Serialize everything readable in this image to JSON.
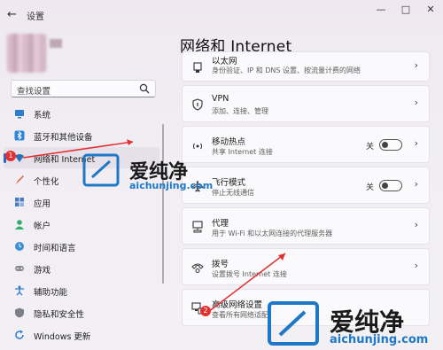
{
  "window": {
    "app_title": "设置",
    "back_glyph": "←",
    "min_glyph": "—",
    "max_glyph": "□",
    "close_glyph": "✕"
  },
  "search": {
    "placeholder": "查找设置"
  },
  "sidebar": {
    "items": [
      {
        "label": "系统",
        "icon": "monitor-icon"
      },
      {
        "label": "蓝牙和其他设备",
        "icon": "bluetooth-icon"
      },
      {
        "label": "网络和 Internet",
        "icon": "wifi-icon",
        "active": true
      },
      {
        "label": "个性化",
        "icon": "brush-icon"
      },
      {
        "label": "应用",
        "icon": "apps-icon"
      },
      {
        "label": "帐户",
        "icon": "account-icon"
      },
      {
        "label": "时间和语言",
        "icon": "globe-clock-icon"
      },
      {
        "label": "游戏",
        "icon": "gamepad-icon"
      },
      {
        "label": "辅助功能",
        "icon": "accessibility-icon"
      },
      {
        "label": "隐私和安全性",
        "icon": "shield-icon"
      },
      {
        "label": "Windows 更新",
        "icon": "update-icon"
      }
    ]
  },
  "main": {
    "title": "网络和 Internet",
    "cards": [
      {
        "title": "以太网",
        "subtitle": "身份验证、IP 和 DNS 设置、按流量计费的网络",
        "icon": "ethernet-icon"
      },
      {
        "title": "VPN",
        "subtitle": "添加、连接、管理",
        "icon": "vpn-shield-icon"
      },
      {
        "title": "移动热点",
        "subtitle": "共享 Internet 连接",
        "icon": "hotspot-icon",
        "toggle_label": "关",
        "toggle_on": false
      },
      {
        "title": "飞行模式",
        "subtitle": "停止无线通信",
        "icon": "airplane-icon",
        "toggle_label": "关",
        "toggle_on": false
      },
      {
        "title": "代理",
        "subtitle": "用于 Wi-Fi 和以太网连接的代理服务器",
        "icon": "proxy-icon"
      },
      {
        "title": "拨号",
        "subtitle": "设置拨号 Internet 连接",
        "icon": "dialup-icon"
      },
      {
        "title": "高级网络设置",
        "subtitle": "查看所有网络适配",
        "icon": "advanced-network-icon"
      }
    ],
    "chevron": "›"
  },
  "annotations": {
    "badge_1": "1",
    "badge_2": "2",
    "watermark_text": "爱纯净",
    "watermark_url": "aichunjing.com"
  },
  "colors": {
    "accent": "#1a6ec7",
    "annotation_red": "#e23030",
    "watermark_blue": "#1e78c8"
  }
}
